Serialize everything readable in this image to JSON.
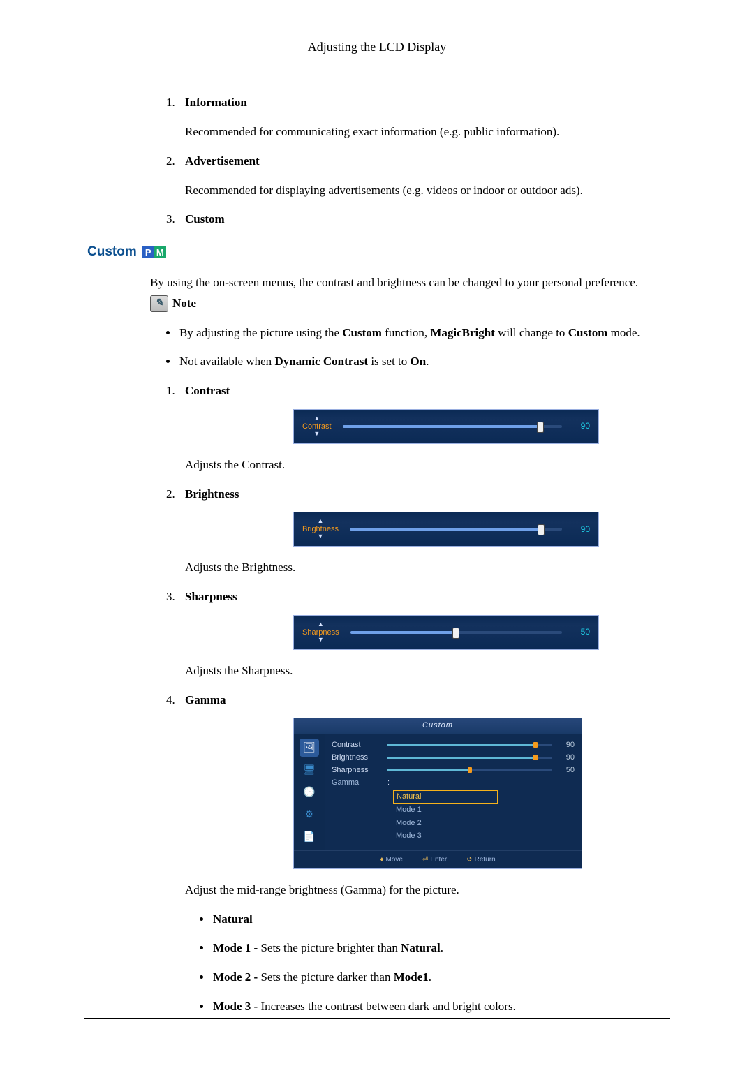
{
  "header": {
    "title": "Adjusting the LCD Display"
  },
  "intro_list": [
    {
      "title": "Information",
      "desc": "Recommended for communicating exact information (e.g. public information)."
    },
    {
      "title": "Advertisement",
      "desc": "Recommended for displaying advertisements (e.g. videos or indoor or outdoor ads)."
    },
    {
      "title": "Custom",
      "desc": ""
    }
  ],
  "section": {
    "heading": "Custom",
    "pm_badge": {
      "p": "P",
      "m": "M"
    },
    "intro": "By using the on-screen menus, the contrast and brightness can be changed to your personal preference.",
    "note_label": "Note",
    "notes": {
      "n1_pre": "By adjusting the picture using the ",
      "n1_b1": "Custom",
      "n1_mid1": " function, ",
      "n1_b2": "MagicBright",
      "n1_mid2": " will change to ",
      "n1_b3": "Custom",
      "n1_post": " mode.",
      "n2_pre": "Not available when ",
      "n2_b1": "Dynamic Contrast",
      "n2_mid": " is set to ",
      "n2_b2": "On",
      "n2_post": "."
    }
  },
  "custom_items": [
    {
      "title": "Contrast",
      "osd_label": "Contrast",
      "value": 90,
      "desc": "Adjusts the Contrast."
    },
    {
      "title": "Brightness",
      "osd_label": "Brightness",
      "value": 90,
      "desc": "Adjusts the Brightness."
    },
    {
      "title": "Sharpness",
      "osd_label": "Sharpness",
      "value": 50,
      "desc": "Adjusts the Sharpness."
    },
    {
      "title": "Gamma",
      "desc": "Adjust the mid-range brightness (Gamma) for the picture."
    }
  ],
  "gamma_menu": {
    "title": "Custom",
    "rows": [
      {
        "label": "Contrast",
        "value": 90
      },
      {
        "label": "Brightness",
        "value": 90
      },
      {
        "label": "Sharpness",
        "value": 50
      }
    ],
    "gamma_label": "Gamma",
    "colon": ":",
    "options": [
      "Natural",
      "Mode 1",
      "Mode 2",
      "Mode 3"
    ],
    "selected": "Natural",
    "footer": {
      "move": "Move",
      "enter": "Enter",
      "return": "Return"
    }
  },
  "gamma_modes": {
    "natural": "Natural",
    "m1_b": "Mode 1 - ",
    "m1_txt": "Sets the picture brighter than ",
    "m1_b2": "Natural",
    "m1_post": ".",
    "m2_b": "Mode 2 - ",
    "m2_txt": "Sets the picture darker than ",
    "m2_b2": "Mode1",
    "m2_post": ".",
    "m3_b": "Mode 3 - ",
    "m3_txt": "Increases the contrast between dark and bright colors."
  }
}
